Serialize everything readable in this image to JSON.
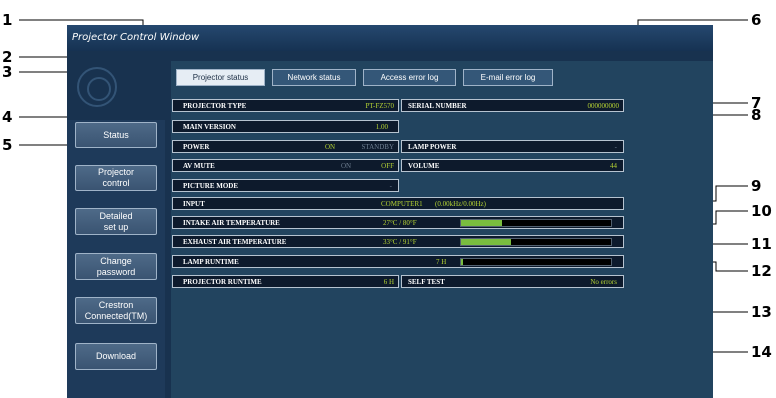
{
  "window_title": "Projector Control Window",
  "sidebar": {
    "buttons": [
      "Status",
      "Projector\ncontrol",
      "Detailed\nset up",
      "Change\npassword",
      "Crestron\nConnected(TM)",
      "Download"
    ]
  },
  "tabs": [
    "Projector status",
    "Network status",
    "Access error log",
    "E-mail error log"
  ],
  "status": {
    "projector_type": {
      "label": "PROJECTOR TYPE",
      "value": "PT-FZ570"
    },
    "serial_number": {
      "label": "SERIAL NUMBER",
      "value": "000000000"
    },
    "main_version": {
      "label": "MAIN VERSION",
      "value": "1.00"
    },
    "power": {
      "label": "POWER",
      "on": "ON",
      "standby": "STANDBY"
    },
    "lamp_power": {
      "label": "LAMP POWER",
      "value": "-"
    },
    "av_mute": {
      "label": "AV MUTE",
      "on": "ON",
      "off": "OFF"
    },
    "volume": {
      "label": "VOLUME",
      "value": "44"
    },
    "picture_mode": {
      "label": "PICTURE MODE",
      "value": "-"
    },
    "input": {
      "label": "INPUT",
      "value": "COMPUTER1",
      "freq": "(0.00kHz/0.00Hz)"
    },
    "intake_temp": {
      "label": "INTAKE AIR TEMPERATURE",
      "value": "27°C / 80°F",
      "level": 0.27
    },
    "exhaust_temp": {
      "label": "EXHAUST AIR TEMPERATURE",
      "value": "33°C / 91°F",
      "level": 0.33
    },
    "lamp_runtime": {
      "label": "LAMP RUNTIME",
      "value": "7 H",
      "level": 0.01
    },
    "projector_runtime": {
      "label": "PROJECTOR RUNTIME",
      "value": "6 H"
    },
    "self_test": {
      "label": "SELF TEST",
      "value": "No errors"
    }
  },
  "callouts": [
    "1",
    "2",
    "3",
    "4",
    "5",
    "6",
    "7",
    "8",
    "9",
    "10",
    "11",
    "12",
    "13",
    "14"
  ]
}
